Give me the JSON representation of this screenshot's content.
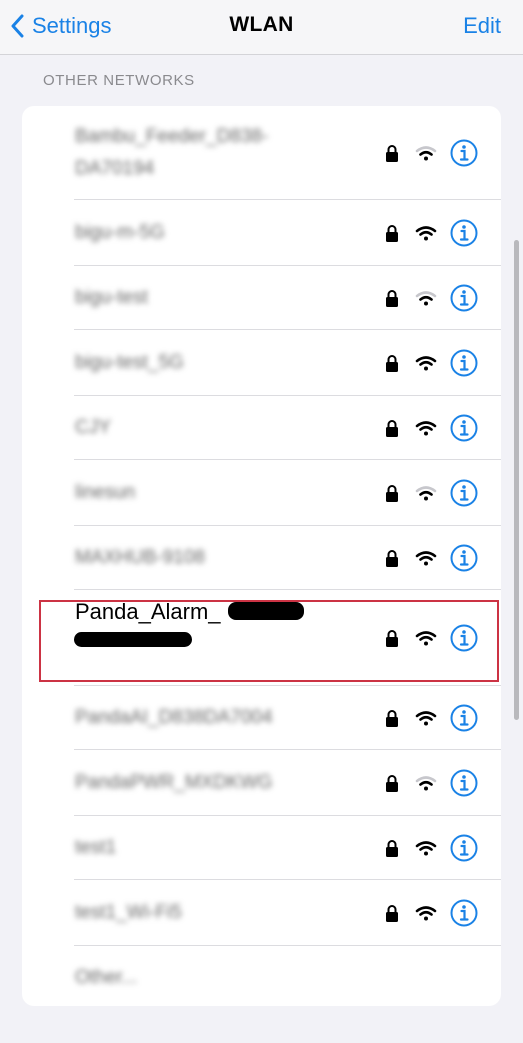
{
  "navbar": {
    "back_label": "Settings",
    "title": "WLAN",
    "edit_label": "Edit"
  },
  "section": {
    "header": "OTHER NETWORKS"
  },
  "networks": [
    {
      "name": "Bambu_Feeder_D838-DA70194",
      "secured": true,
      "signal": "medium"
    },
    {
      "name": "bigu-m-5G",
      "secured": true,
      "signal": "strong"
    },
    {
      "name": "bigu-test",
      "secured": true,
      "signal": "medium"
    },
    {
      "name": "bigu-test_5G",
      "secured": true,
      "signal": "strong"
    },
    {
      "name": "CJY",
      "secured": true,
      "signal": "strong"
    },
    {
      "name": "linesun",
      "secured": true,
      "signal": "medium"
    },
    {
      "name": "MAXHUB-9108",
      "secured": true,
      "signal": "strong"
    },
    {
      "name": "Panda_Alarm_",
      "secured": true,
      "signal": "strong"
    },
    {
      "name": "PandaAI_D838DA7004",
      "secured": true,
      "signal": "strong"
    },
    {
      "name": "PandaPWR_MXDKWG",
      "secured": true,
      "signal": "medium"
    },
    {
      "name": "test1",
      "secured": true,
      "signal": "strong"
    },
    {
      "name": "test1_Wi-Fi5",
      "secured": true,
      "signal": "strong"
    }
  ],
  "other_label": "Other...",
  "colors": {
    "accent": "#1a82e6",
    "highlight": "#cc3344",
    "background": "#f2f2f7"
  }
}
